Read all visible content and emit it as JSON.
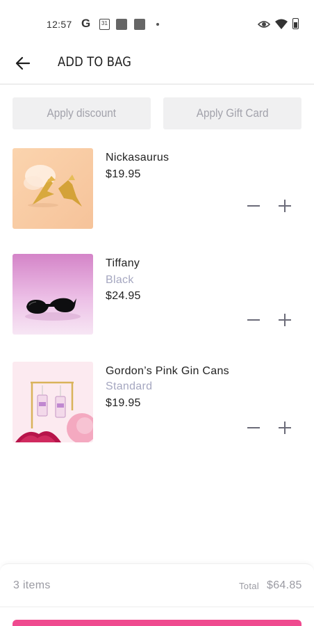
{
  "status_bar": {
    "time": "12:57",
    "google_icon": "G",
    "calendar_day": "31",
    "icons": [
      "google-icon",
      "calendar-icon",
      "notification-icon",
      "notification-icon",
      "dot-icon",
      "eye-icon",
      "wifi-icon",
      "battery-icon"
    ]
  },
  "header": {
    "title": "ADD TO BAG",
    "back_icon": "arrow-left-icon"
  },
  "actions": {
    "apply_discount": "Apply discount",
    "apply_gift_card": "Apply Gift Card"
  },
  "items": [
    {
      "name": "Nickasaurus",
      "variant": "",
      "price": "$19.95",
      "image": "gold-dinosaur-earrings"
    },
    {
      "name": "Tiffany",
      "variant": "Black",
      "price": "$24.95",
      "image": "black-sunglasses"
    },
    {
      "name": "Gordon’s Pink Gin Cans",
      "variant": "Standard",
      "price": "$19.95",
      "image": "pink-gin-can-earrings"
    }
  ],
  "summary": {
    "count": "3 items",
    "total_label": "Total",
    "total_value": "$64.85"
  },
  "colors": {
    "accent": "#ef4a8f",
    "variant_text": "#a5a7c0",
    "button_bg": "#f0f0f1",
    "muted_text": "#9a9aa2"
  }
}
